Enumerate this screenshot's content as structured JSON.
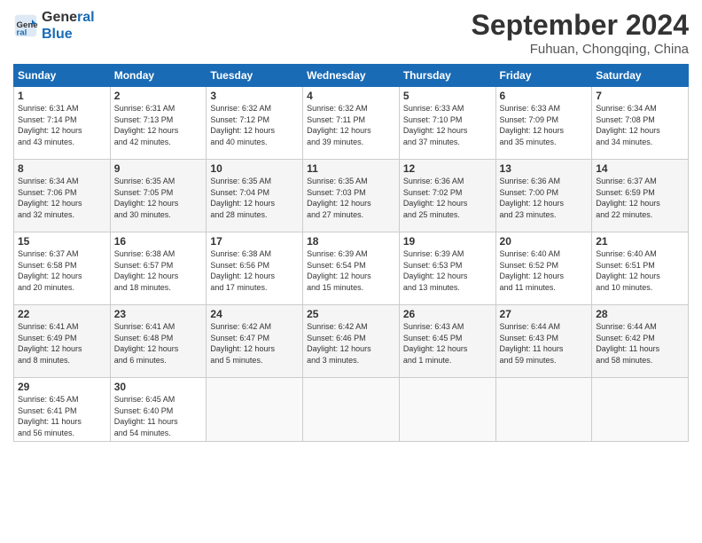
{
  "header": {
    "logo_line1": "General",
    "logo_line2": "Blue",
    "month_year": "September 2024",
    "location": "Fuhuan, Chongqing, China"
  },
  "weekdays": [
    "Sunday",
    "Monday",
    "Tuesday",
    "Wednesday",
    "Thursday",
    "Friday",
    "Saturday"
  ],
  "weeks": [
    [
      {
        "day": "1",
        "info": "Sunrise: 6:31 AM\nSunset: 7:14 PM\nDaylight: 12 hours\nand 43 minutes."
      },
      {
        "day": "2",
        "info": "Sunrise: 6:31 AM\nSunset: 7:13 PM\nDaylight: 12 hours\nand 42 minutes."
      },
      {
        "day": "3",
        "info": "Sunrise: 6:32 AM\nSunset: 7:12 PM\nDaylight: 12 hours\nand 40 minutes."
      },
      {
        "day": "4",
        "info": "Sunrise: 6:32 AM\nSunset: 7:11 PM\nDaylight: 12 hours\nand 39 minutes."
      },
      {
        "day": "5",
        "info": "Sunrise: 6:33 AM\nSunset: 7:10 PM\nDaylight: 12 hours\nand 37 minutes."
      },
      {
        "day": "6",
        "info": "Sunrise: 6:33 AM\nSunset: 7:09 PM\nDaylight: 12 hours\nand 35 minutes."
      },
      {
        "day": "7",
        "info": "Sunrise: 6:34 AM\nSunset: 7:08 PM\nDaylight: 12 hours\nand 34 minutes."
      }
    ],
    [
      {
        "day": "8",
        "info": "Sunrise: 6:34 AM\nSunset: 7:06 PM\nDaylight: 12 hours\nand 32 minutes."
      },
      {
        "day": "9",
        "info": "Sunrise: 6:35 AM\nSunset: 7:05 PM\nDaylight: 12 hours\nand 30 minutes."
      },
      {
        "day": "10",
        "info": "Sunrise: 6:35 AM\nSunset: 7:04 PM\nDaylight: 12 hours\nand 28 minutes."
      },
      {
        "day": "11",
        "info": "Sunrise: 6:35 AM\nSunset: 7:03 PM\nDaylight: 12 hours\nand 27 minutes."
      },
      {
        "day": "12",
        "info": "Sunrise: 6:36 AM\nSunset: 7:02 PM\nDaylight: 12 hours\nand 25 minutes."
      },
      {
        "day": "13",
        "info": "Sunrise: 6:36 AM\nSunset: 7:00 PM\nDaylight: 12 hours\nand 23 minutes."
      },
      {
        "day": "14",
        "info": "Sunrise: 6:37 AM\nSunset: 6:59 PM\nDaylight: 12 hours\nand 22 minutes."
      }
    ],
    [
      {
        "day": "15",
        "info": "Sunrise: 6:37 AM\nSunset: 6:58 PM\nDaylight: 12 hours\nand 20 minutes."
      },
      {
        "day": "16",
        "info": "Sunrise: 6:38 AM\nSunset: 6:57 PM\nDaylight: 12 hours\nand 18 minutes."
      },
      {
        "day": "17",
        "info": "Sunrise: 6:38 AM\nSunset: 6:56 PM\nDaylight: 12 hours\nand 17 minutes."
      },
      {
        "day": "18",
        "info": "Sunrise: 6:39 AM\nSunset: 6:54 PM\nDaylight: 12 hours\nand 15 minutes."
      },
      {
        "day": "19",
        "info": "Sunrise: 6:39 AM\nSunset: 6:53 PM\nDaylight: 12 hours\nand 13 minutes."
      },
      {
        "day": "20",
        "info": "Sunrise: 6:40 AM\nSunset: 6:52 PM\nDaylight: 12 hours\nand 11 minutes."
      },
      {
        "day": "21",
        "info": "Sunrise: 6:40 AM\nSunset: 6:51 PM\nDaylight: 12 hours\nand 10 minutes."
      }
    ],
    [
      {
        "day": "22",
        "info": "Sunrise: 6:41 AM\nSunset: 6:49 PM\nDaylight: 12 hours\nand 8 minutes."
      },
      {
        "day": "23",
        "info": "Sunrise: 6:41 AM\nSunset: 6:48 PM\nDaylight: 12 hours\nand 6 minutes."
      },
      {
        "day": "24",
        "info": "Sunrise: 6:42 AM\nSunset: 6:47 PM\nDaylight: 12 hours\nand 5 minutes."
      },
      {
        "day": "25",
        "info": "Sunrise: 6:42 AM\nSunset: 6:46 PM\nDaylight: 12 hours\nand 3 minutes."
      },
      {
        "day": "26",
        "info": "Sunrise: 6:43 AM\nSunset: 6:45 PM\nDaylight: 12 hours\nand 1 minute."
      },
      {
        "day": "27",
        "info": "Sunrise: 6:44 AM\nSunset: 6:43 PM\nDaylight: 11 hours\nand 59 minutes."
      },
      {
        "day": "28",
        "info": "Sunrise: 6:44 AM\nSunset: 6:42 PM\nDaylight: 11 hours\nand 58 minutes."
      }
    ],
    [
      {
        "day": "29",
        "info": "Sunrise: 6:45 AM\nSunset: 6:41 PM\nDaylight: 11 hours\nand 56 minutes."
      },
      {
        "day": "30",
        "info": "Sunrise: 6:45 AM\nSunset: 6:40 PM\nDaylight: 11 hours\nand 54 minutes."
      },
      {
        "day": "",
        "info": ""
      },
      {
        "day": "",
        "info": ""
      },
      {
        "day": "",
        "info": ""
      },
      {
        "day": "",
        "info": ""
      },
      {
        "day": "",
        "info": ""
      }
    ]
  ]
}
